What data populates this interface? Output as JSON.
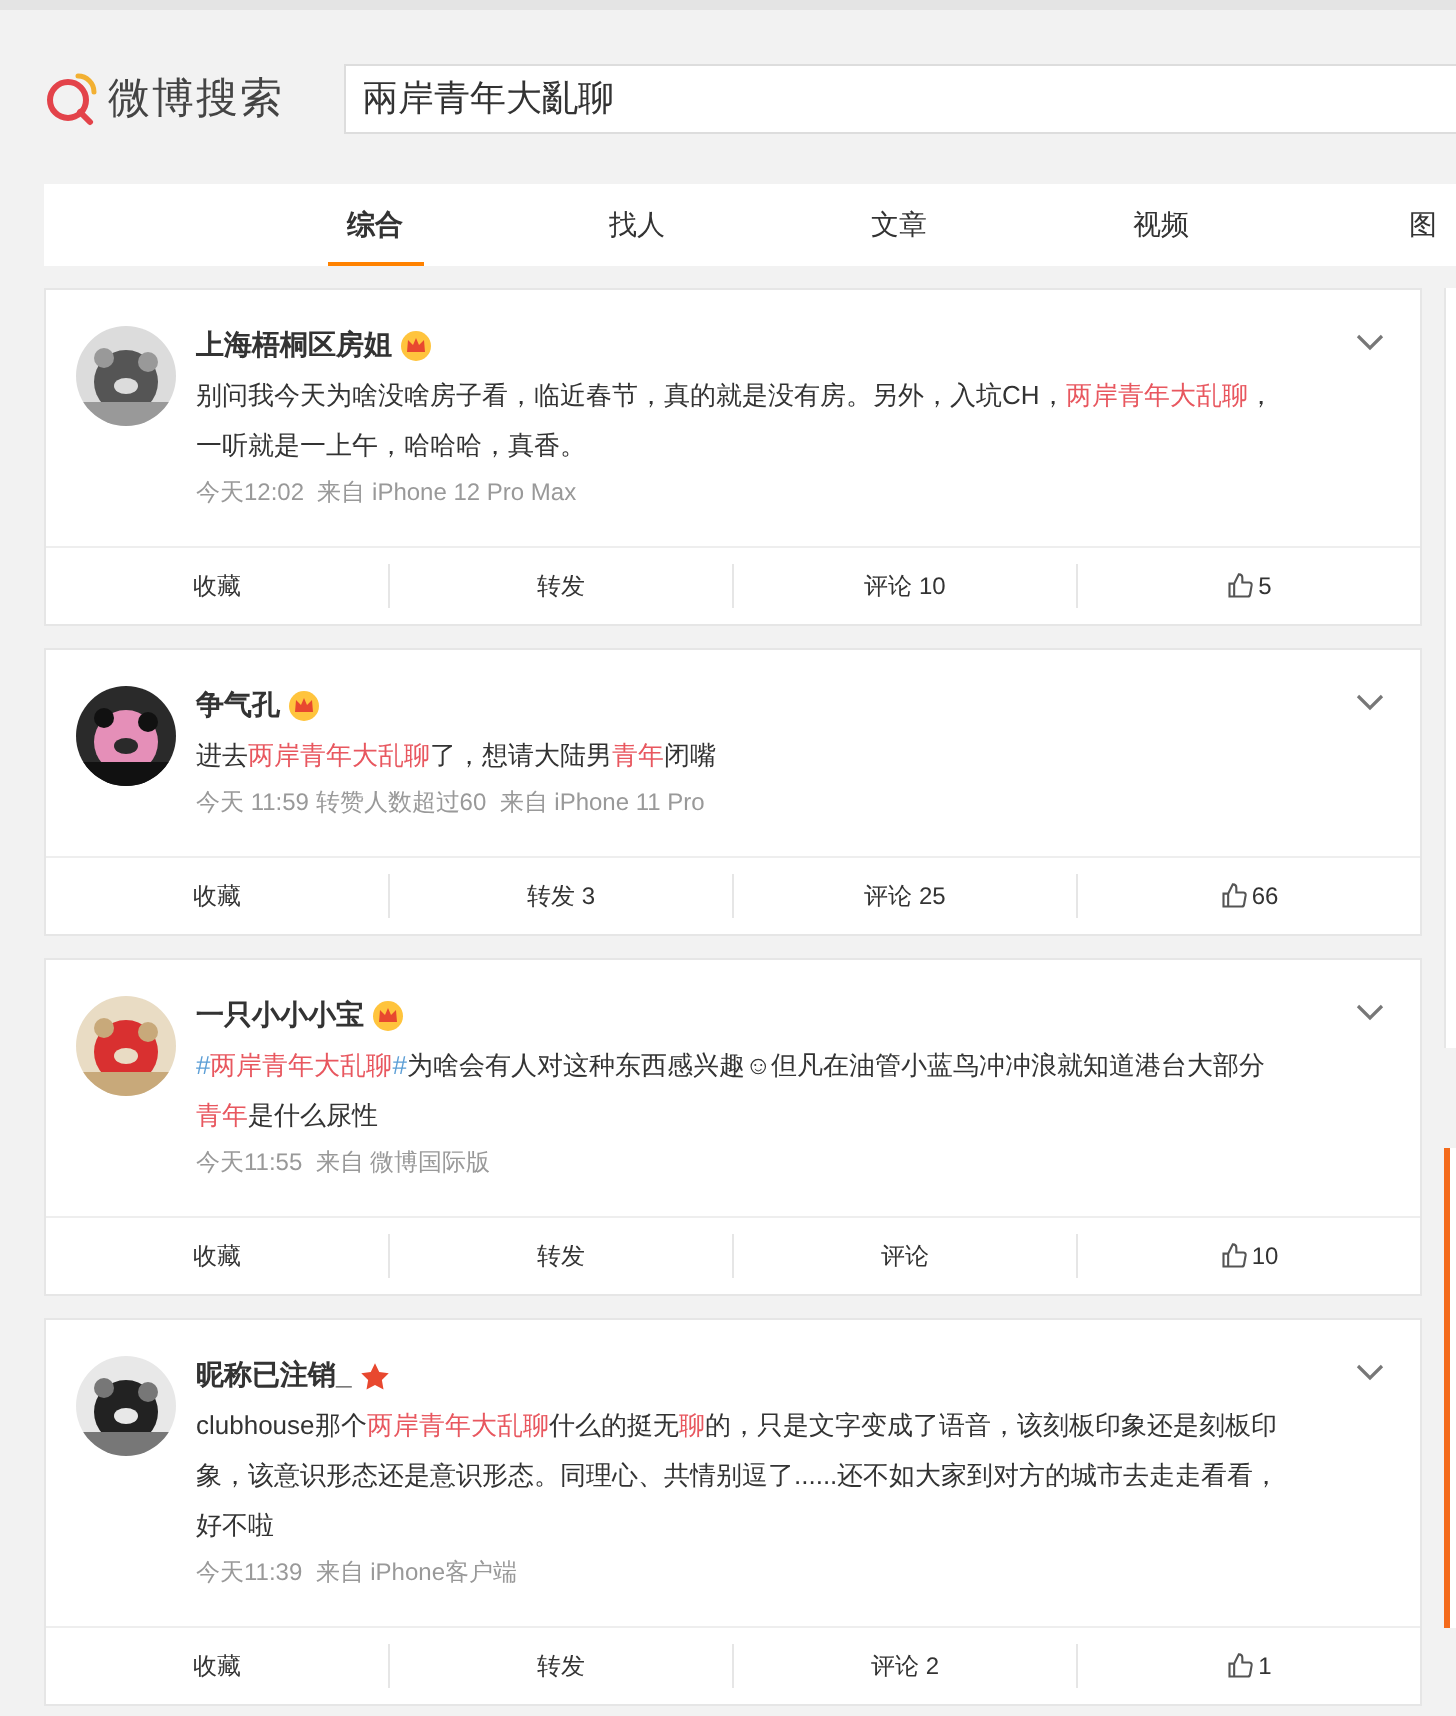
{
  "header": {
    "logo_text": "微博搜索",
    "search": {
      "value": "兩岸青年大亂聊"
    }
  },
  "tabs": [
    {
      "label": "综合",
      "selected": true
    },
    {
      "label": "找人",
      "selected": false
    },
    {
      "label": "文章",
      "selected": false
    },
    {
      "label": "视频",
      "selected": false
    },
    {
      "label": "图",
      "selected": false
    }
  ],
  "posts": [
    {
      "author": "上海梧桐区房姐",
      "crown_badge": true,
      "star_badge": false,
      "text": [
        {
          "kind": "plain",
          "text": "别问我今天为啥没啥房子看，临近春节，真的就是没有房。另外，入坑CH，"
        },
        {
          "kind": "keyword",
          "text": "两岸青年大乱聊"
        },
        {
          "kind": "plain",
          "text": "，一听就是一上午，哈哈哈，真香。"
        }
      ],
      "meta": "今天12:02  来自 iPhone 12 Pro Max",
      "actions": {
        "favorite": "收藏",
        "repost": "转发",
        "comment": "评论 10",
        "like": "5"
      }
    },
    {
      "author": "争气孔",
      "crown_badge": true,
      "star_badge": false,
      "text": [
        {
          "kind": "plain",
          "text": "进去"
        },
        {
          "kind": "keyword",
          "text": "两岸青年大乱聊"
        },
        {
          "kind": "plain",
          "text": "了，想请大陆男"
        },
        {
          "kind": "keyword",
          "text": "青年"
        },
        {
          "kind": "plain",
          "text": "闭嘴"
        }
      ],
      "meta": "今天 11:59 转赞人数超过60  来自 iPhone 11 Pro",
      "actions": {
        "favorite": "收藏",
        "repost": "转发 3",
        "comment": "评论 25",
        "like": "66"
      }
    },
    {
      "author": "一只小小小宝",
      "crown_badge": true,
      "star_badge": false,
      "text": [
        {
          "kind": "hashtag",
          "text": "#"
        },
        {
          "kind": "keyword",
          "text": "两岸青年大乱聊"
        },
        {
          "kind": "hashtag",
          "text": "#"
        },
        {
          "kind": "plain",
          "text": "为啥会有人对这种东西感兴趣☺但凡在油管小蓝鸟冲冲浪就知道港台大部分"
        },
        {
          "kind": "keyword",
          "text": "青年"
        },
        {
          "kind": "plain",
          "text": "是什么尿性"
        }
      ],
      "meta": "今天11:55  来自 微博国际版",
      "actions": {
        "favorite": "收藏",
        "repost": "转发",
        "comment": "评论",
        "like": "10"
      }
    },
    {
      "author": "昵称已注销_",
      "crown_badge": false,
      "star_badge": true,
      "text": [
        {
          "kind": "plain",
          "text": "clubhouse那个"
        },
        {
          "kind": "keyword",
          "text": "两岸青年大乱聊"
        },
        {
          "kind": "plain",
          "text": "什么的挺无"
        },
        {
          "kind": "keyword",
          "text": "聊"
        },
        {
          "kind": "plain",
          "text": "的，只是文字变成了语音，该刻板印象还是刻板印象，该意识形态还是意识形态。同理心、共情别逗了......还不如大家到对方的城市去走走看看，好不啦"
        }
      ],
      "meta": "今天11:39  来自 iPhone客户端",
      "actions": {
        "favorite": "收藏",
        "repost": "转发",
        "comment": "评论 2",
        "like": "1"
      }
    }
  ]
}
